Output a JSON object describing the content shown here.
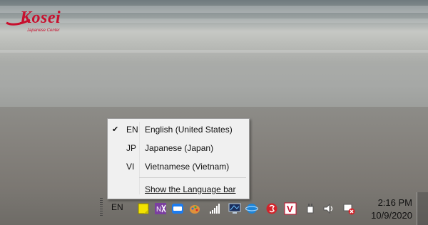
{
  "logo": {
    "brand": "Kosei",
    "subtitle": "Japanese Center"
  },
  "language_menu": {
    "items": [
      {
        "code": "EN",
        "label": "English (United States)",
        "checked": true
      },
      {
        "code": "JP",
        "label": "Japanese (Japan)",
        "checked": false
      },
      {
        "code": "VI",
        "label": "Vietnamese (Vietnam)",
        "checked": false
      }
    ],
    "check_mark": "✔",
    "show_language_bar": "Show the Language bar"
  },
  "taskbar": {
    "language_indicator": "EN",
    "clock": {
      "time": "2:16 PM",
      "date": "10/9/2020"
    },
    "tray_icons": [
      "sticky-notes-icon",
      "snipping-tool-icon",
      "zalo-icon",
      "paint-icon",
      "network-signal-icon",
      "display-icon",
      "browser-icon",
      "red-circle-app-icon",
      "vector-v-icon",
      "power-plug-icon",
      "volume-icon",
      "network-error-icon"
    ]
  }
}
